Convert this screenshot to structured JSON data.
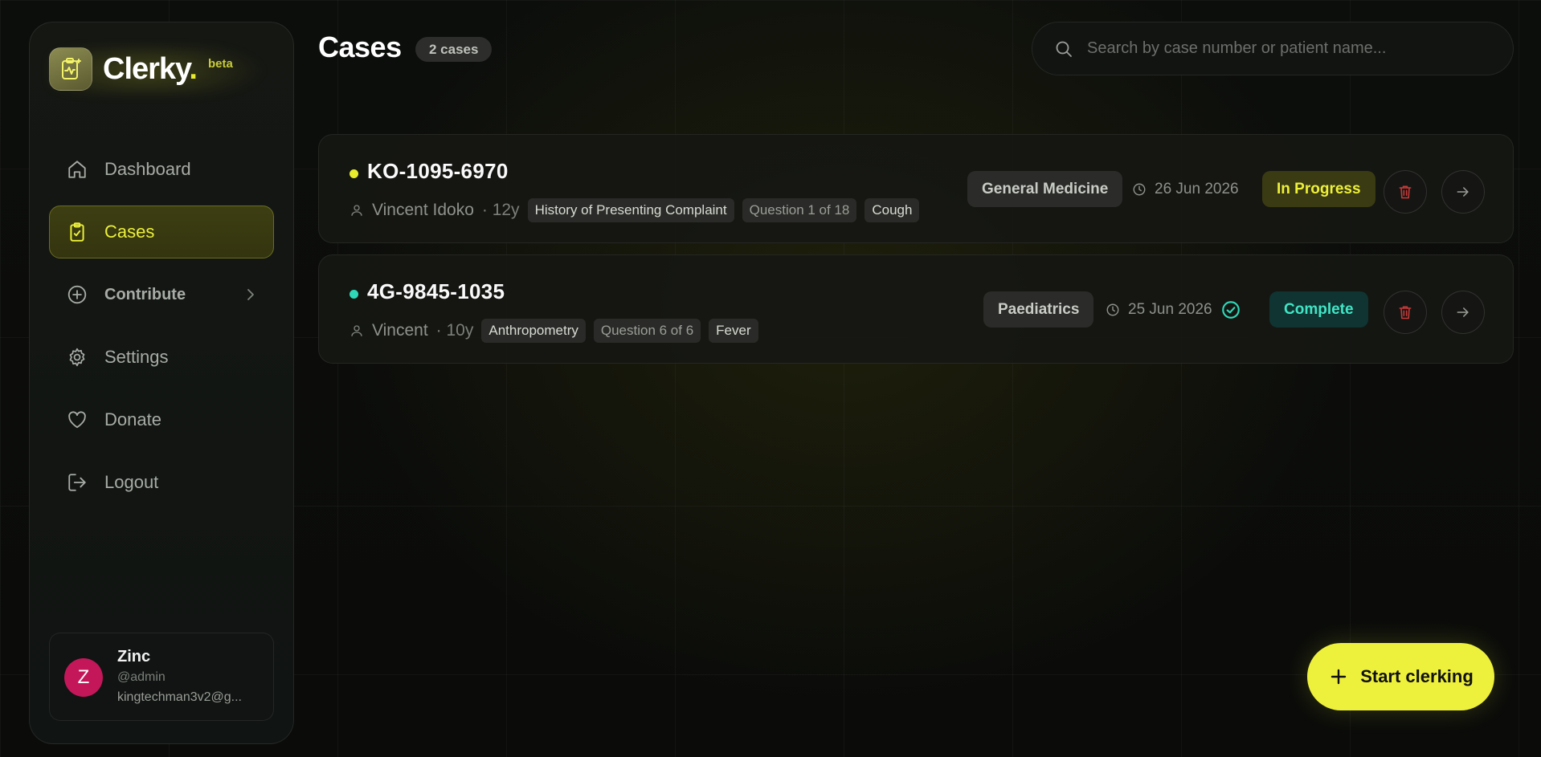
{
  "brand": {
    "name": "Clerky",
    "dot": ".",
    "badge": "beta"
  },
  "nav": {
    "items": [
      {
        "label": "Dashboard",
        "icon": "home-icon"
      },
      {
        "label": "Cases",
        "icon": "clipboard-check-icon",
        "active": true
      },
      {
        "label": "Contribute",
        "icon": "plus-circle-icon"
      },
      {
        "label": "Settings",
        "icon": "gear-icon"
      },
      {
        "label": "Donate",
        "icon": "heart-icon"
      },
      {
        "label": "Logout",
        "icon": "logout-icon"
      }
    ]
  },
  "user": {
    "initial": "Z",
    "name": "Zinc",
    "handle": "@admin",
    "email": "kingtechman3v2@g..."
  },
  "header": {
    "title": "Cases",
    "count": "2 cases"
  },
  "search": {
    "placeholder": "Search by case number or patient name..."
  },
  "cases": [
    {
      "number": "KO-1095-6970",
      "dot_color": "#e8ec2c",
      "patient": "Vincent Idoko",
      "age": "· 12y",
      "section": "History of Presenting Complaint",
      "question": "Question 1 of 18",
      "complaint": "Cough",
      "specialty": "General Medicine",
      "date": "26 Jun 2026",
      "status": "In Progress"
    },
    {
      "number": "4G-9845-1035",
      "dot_color": "#2fd8b8",
      "patient": "Vincent",
      "age": "· 10y",
      "section": "Anthropometry",
      "question": "Question 6 of 6",
      "complaint": "Fever",
      "specialty": "Paediatrics",
      "date": "25 Jun 2026",
      "status": "Complete"
    }
  ],
  "fab": {
    "label": "Start clerking"
  },
  "colors": {
    "accent": "#eef13c",
    "complete": "#41e5c6",
    "delete": "#c73a3a"
  }
}
